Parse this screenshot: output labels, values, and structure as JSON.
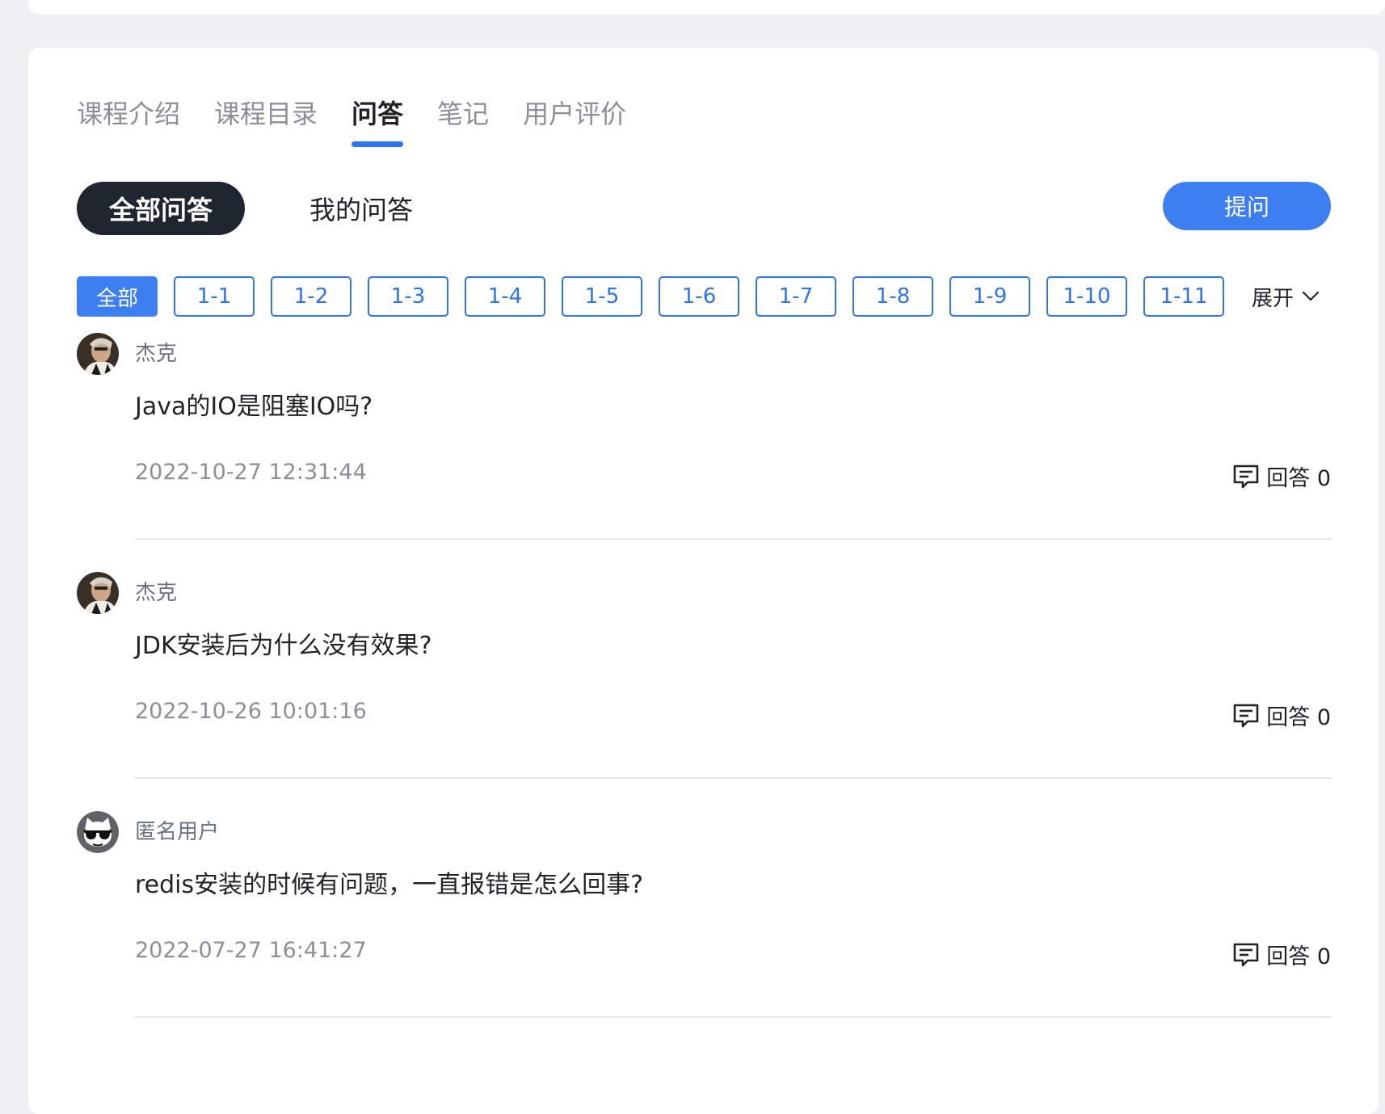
{
  "tabs": [
    {
      "label": "课程介绍",
      "active": false
    },
    {
      "label": "课程目录",
      "active": false
    },
    {
      "label": "问答",
      "active": true
    },
    {
      "label": "笔记",
      "active": false
    },
    {
      "label": "用户评价",
      "active": false
    }
  ],
  "subtabs": {
    "all": "全部问答",
    "mine": "我的问答"
  },
  "ask_button": "提问",
  "chips": [
    "全部",
    "1-1",
    "1-2",
    "1-3",
    "1-4",
    "1-5",
    "1-6",
    "1-7",
    "1-8",
    "1-9",
    "1-10",
    "1-11"
  ],
  "expand_label": "展开",
  "questions": [
    {
      "user": "杰克",
      "avatar": "user-photo-avatar",
      "title": "Java的IO是阻塞IO吗?",
      "time": "2022-10-27 12:31:44",
      "answers_label": "回答 0"
    },
    {
      "user": "杰克",
      "avatar": "user-photo-avatar",
      "title": "JDK安装后为什么没有效果?",
      "time": "2022-10-26 10:01:16",
      "answers_label": "回答 0"
    },
    {
      "user": "匿名用户",
      "avatar": "anonymous-sunglasses-avatar",
      "title": "redis安装的时候有问题，一直报错是怎么回事?",
      "time": "2022-07-27 16:41:27",
      "answers_label": "回答 0"
    }
  ],
  "colors": {
    "accent": "#2f74ec",
    "button_blue": "#3d7ff0",
    "dark_pill": "#1f262f",
    "page_bg": "#eff0f3"
  }
}
